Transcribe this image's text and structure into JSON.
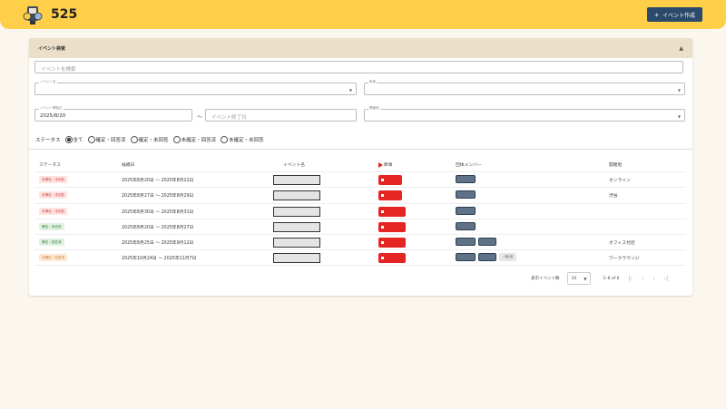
{
  "header": {
    "title": "525",
    "create_button": "イベント作成",
    "create_icon": "plus-icon"
  },
  "search": {
    "section_title": "イベント検索",
    "keyword_placeholder": "イベントを検索",
    "event_name_label": "イベント名",
    "organizer_label": "幹事",
    "start_date_label": "イベント開始日",
    "start_date_value": "2025/8/20",
    "end_date_placeholder": "イベント終了日",
    "venue_label": "開催地",
    "status_label": "ステータス",
    "status_options": [
      "全て",
      "確定・回答済",
      "確定・未回答",
      "未確定・回答済",
      "未確定・未回答"
    ],
    "status_selected": "全て"
  },
  "table": {
    "headers": [
      "ステータス",
      "候補日",
      "イベント名",
      "幹事",
      "団体メンバー",
      "開催地"
    ],
    "rows": [
      {
        "status": "未確定・未回答",
        "status_kind": "unconfirmed",
        "dates": "2025年8月20日 〜 2025年8月22日",
        "members": 1,
        "more": "",
        "venue": "オンライン"
      },
      {
        "status": "未確定・未回答",
        "status_kind": "unconfirmed",
        "dates": "2025年8月27日 〜 2025年8月29日",
        "members": 1,
        "more": "",
        "venue": "渋谷"
      },
      {
        "status": "未確定・未回答",
        "status_kind": "unconfirmed",
        "dates": "2025年8月30日 〜 2025年8月31日",
        "members": 1,
        "more": "",
        "venue": ""
      },
      {
        "status": "確定・未回答",
        "status_kind": "confirmed",
        "dates": "2025年8月20日 〜 2025年8月27日",
        "members": 1,
        "more": "",
        "venue": ""
      },
      {
        "status": "確定・回答済",
        "status_kind": "confirmed",
        "dates": "2025年8月25日 〜 2025年9月12日",
        "members": 2,
        "more": "",
        "venue": "オフィス付近"
      },
      {
        "status": "未確定・回答済",
        "status_kind": "orange",
        "dates": "2025年10月24日 〜 2025年11月7日",
        "members": 2,
        "more": "...他4名",
        "venue": "ワークラウンジ"
      }
    ]
  },
  "pagination": {
    "rows_per_page_label": "表示イベント数",
    "rows_per_page": "10",
    "range": "1–6 of 6"
  },
  "colors": {
    "header_bg": "#ffcf4a",
    "accent": "#2b4a6b",
    "organizer_red": "#e52424"
  }
}
